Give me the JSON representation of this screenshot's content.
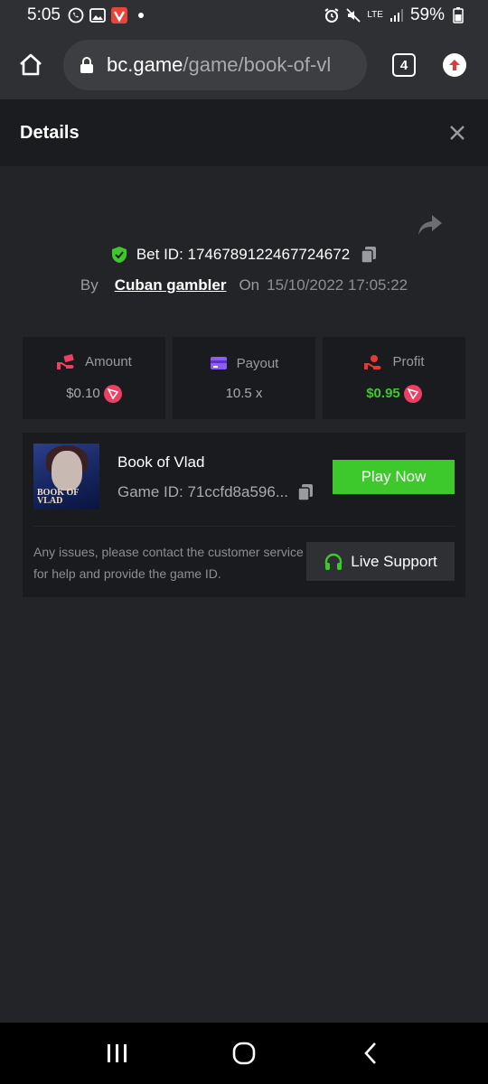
{
  "status_bar": {
    "time": "5:05",
    "battery": "59%",
    "network": "LTE"
  },
  "browser": {
    "url_domain": "bc.game",
    "url_path": "/game/book-of-vl",
    "tab_count": "4"
  },
  "header": {
    "title": "Details"
  },
  "bet": {
    "id_label": "Bet ID: 1746789122467724672",
    "by_label": "By",
    "username": "Cuban gambler",
    "on_label": "On",
    "date": "15/10/2022 17:05:22"
  },
  "stats": [
    {
      "label": "Amount",
      "value": "$0.10",
      "icon": "amount-hand-icon"
    },
    {
      "label": "Payout",
      "value": "10.5 x",
      "icon": "card-icon"
    },
    {
      "label": "Profit",
      "value": "$0.95",
      "icon": "profit-hand-icon"
    }
  ],
  "game": {
    "name": "Book of Vlad",
    "id_label": "Game ID: 71ccfd8a596...",
    "thumb_text": "BOOK OF VLAD",
    "play_label": "Play Now",
    "issue_text": "Any issues, please contact the customer service for help and provide the game ID.",
    "support_label": "Live Support"
  },
  "colors": {
    "accent_green": "#3dc82c",
    "coin_red": "#ec3f62",
    "background": "#232427"
  }
}
